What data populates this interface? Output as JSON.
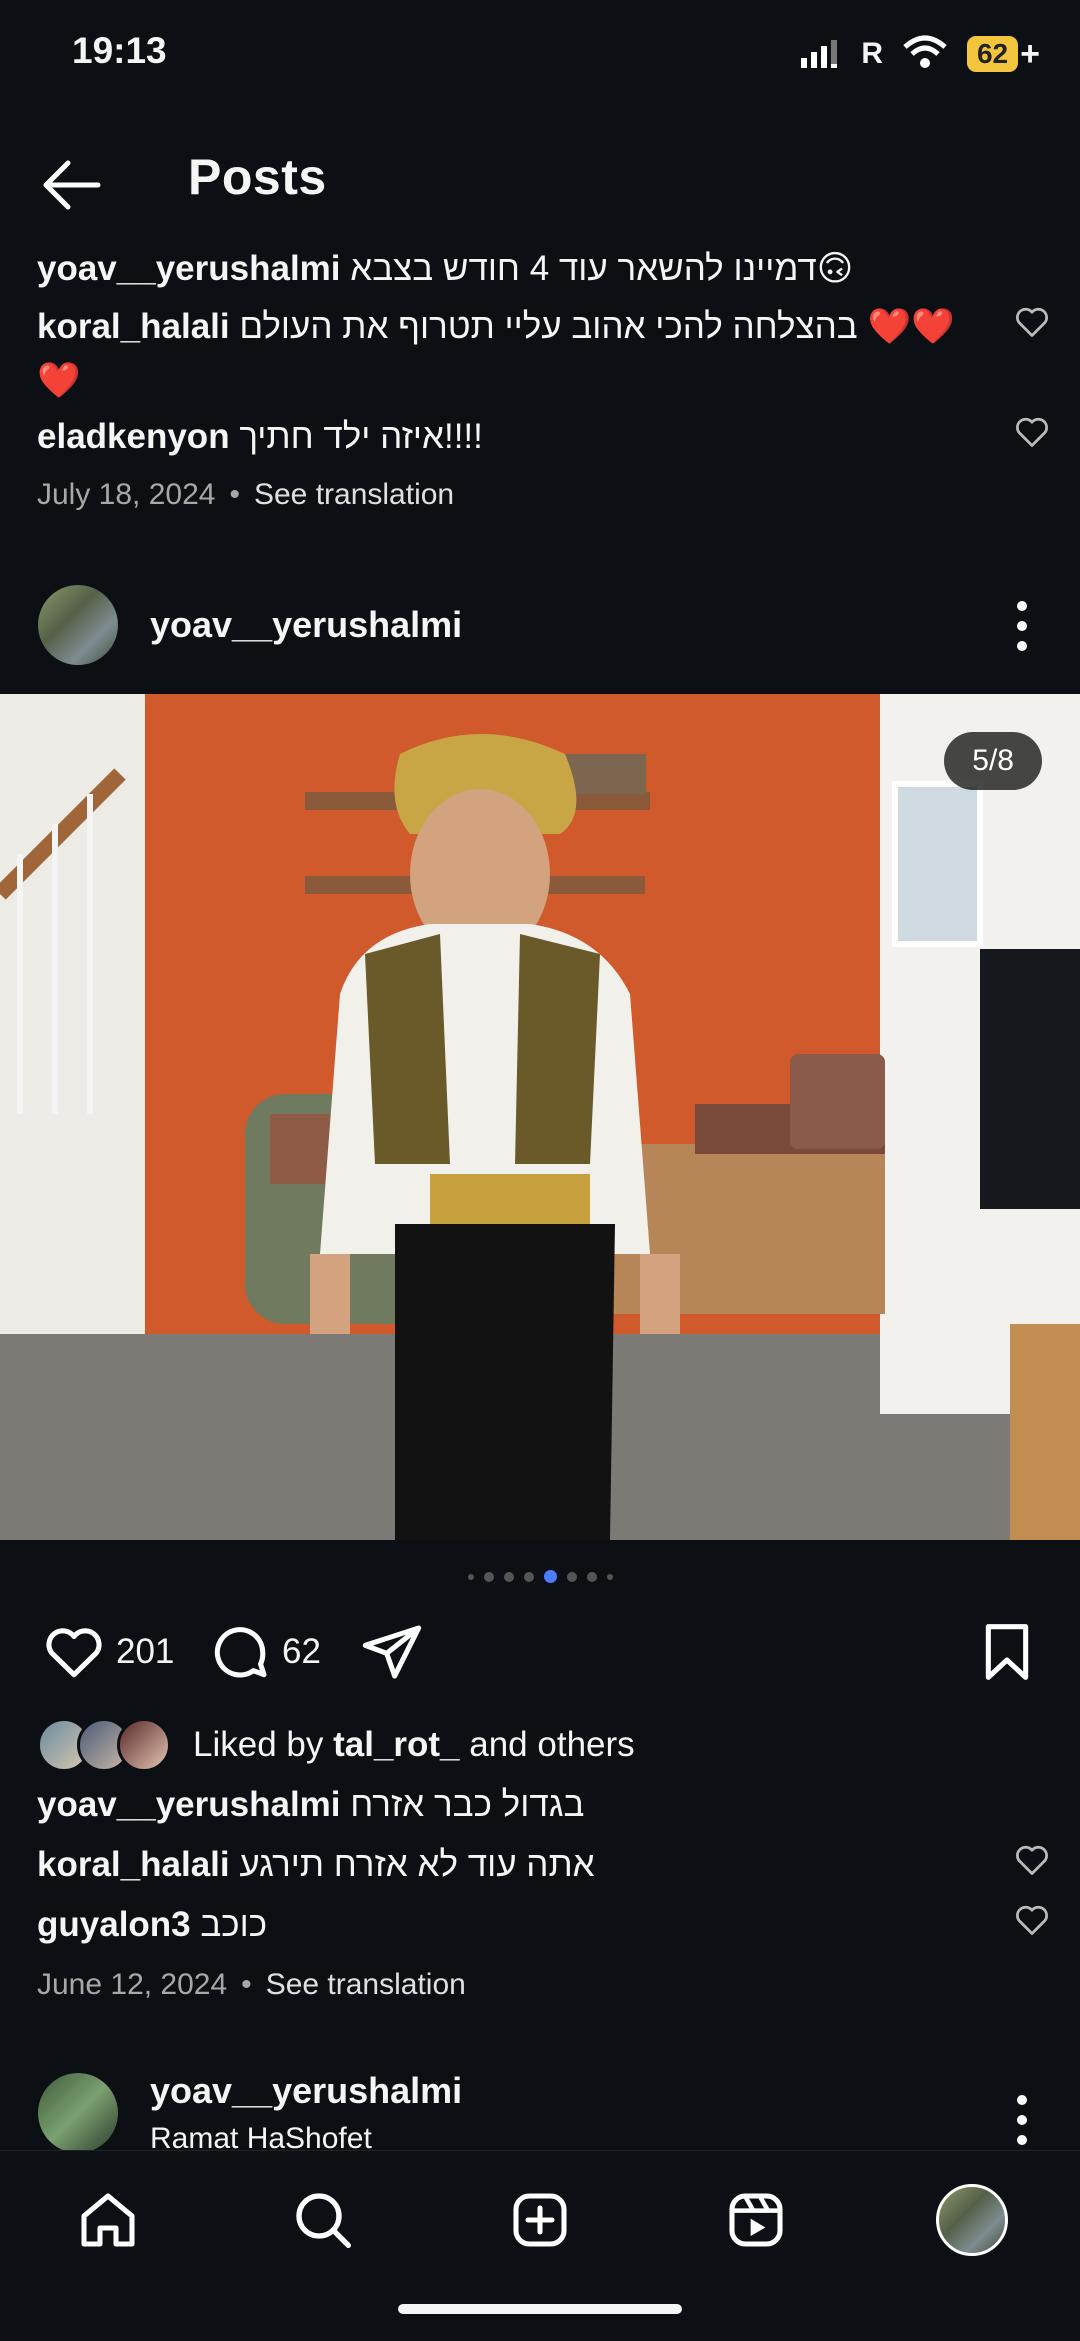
{
  "status_bar": {
    "time": "19:13",
    "battery": "62",
    "network": "R"
  },
  "header": {
    "title": "Posts"
  },
  "prev_post": {
    "caption": {
      "user": "yoav__yerushalmi",
      "text": "דמיינו להשאר עוד 4 חודש בצבא🙃"
    },
    "comments": [
      {
        "user": "koral_halali",
        "text": "בהצלחה להכי אהוב עליי תטרוף את העולם ❤️❤️",
        "text2": "❤️"
      },
      {
        "user": "eladkenyon",
        "text": "איזה ילד חתיך!!!!"
      }
    ],
    "date": "July 18, 2024",
    "see_translation": "See translation"
  },
  "post": {
    "user": "yoav__yerushalmi",
    "counter": "5/8",
    "carousel": {
      "total": 8,
      "active": 5
    },
    "likes": "201",
    "comments_count": "62",
    "liked_by": {
      "prefix": "Liked by ",
      "user": "tal_rot_",
      "suffix": " and others"
    },
    "caption": {
      "user": "yoav__yerushalmi",
      "text": "בגדול כבר אזרח"
    },
    "comments": [
      {
        "user": "koral_halali",
        "text": "אתה עוד לא אזרח תירגע"
      },
      {
        "user": "guyalon3",
        "text": "כוכב"
      }
    ],
    "date": "June 12, 2024",
    "see_translation": "See translation"
  },
  "next_post": {
    "user": "yoav__yerushalmi",
    "location": "Ramat HaShofet"
  },
  "nav": [
    "home-icon",
    "search-icon",
    "create-icon",
    "reels-icon",
    "profile-avatar"
  ],
  "colors": {
    "background": "#0c1014",
    "accent_dot": "#4d7cff",
    "battery": "#f2c53d"
  }
}
